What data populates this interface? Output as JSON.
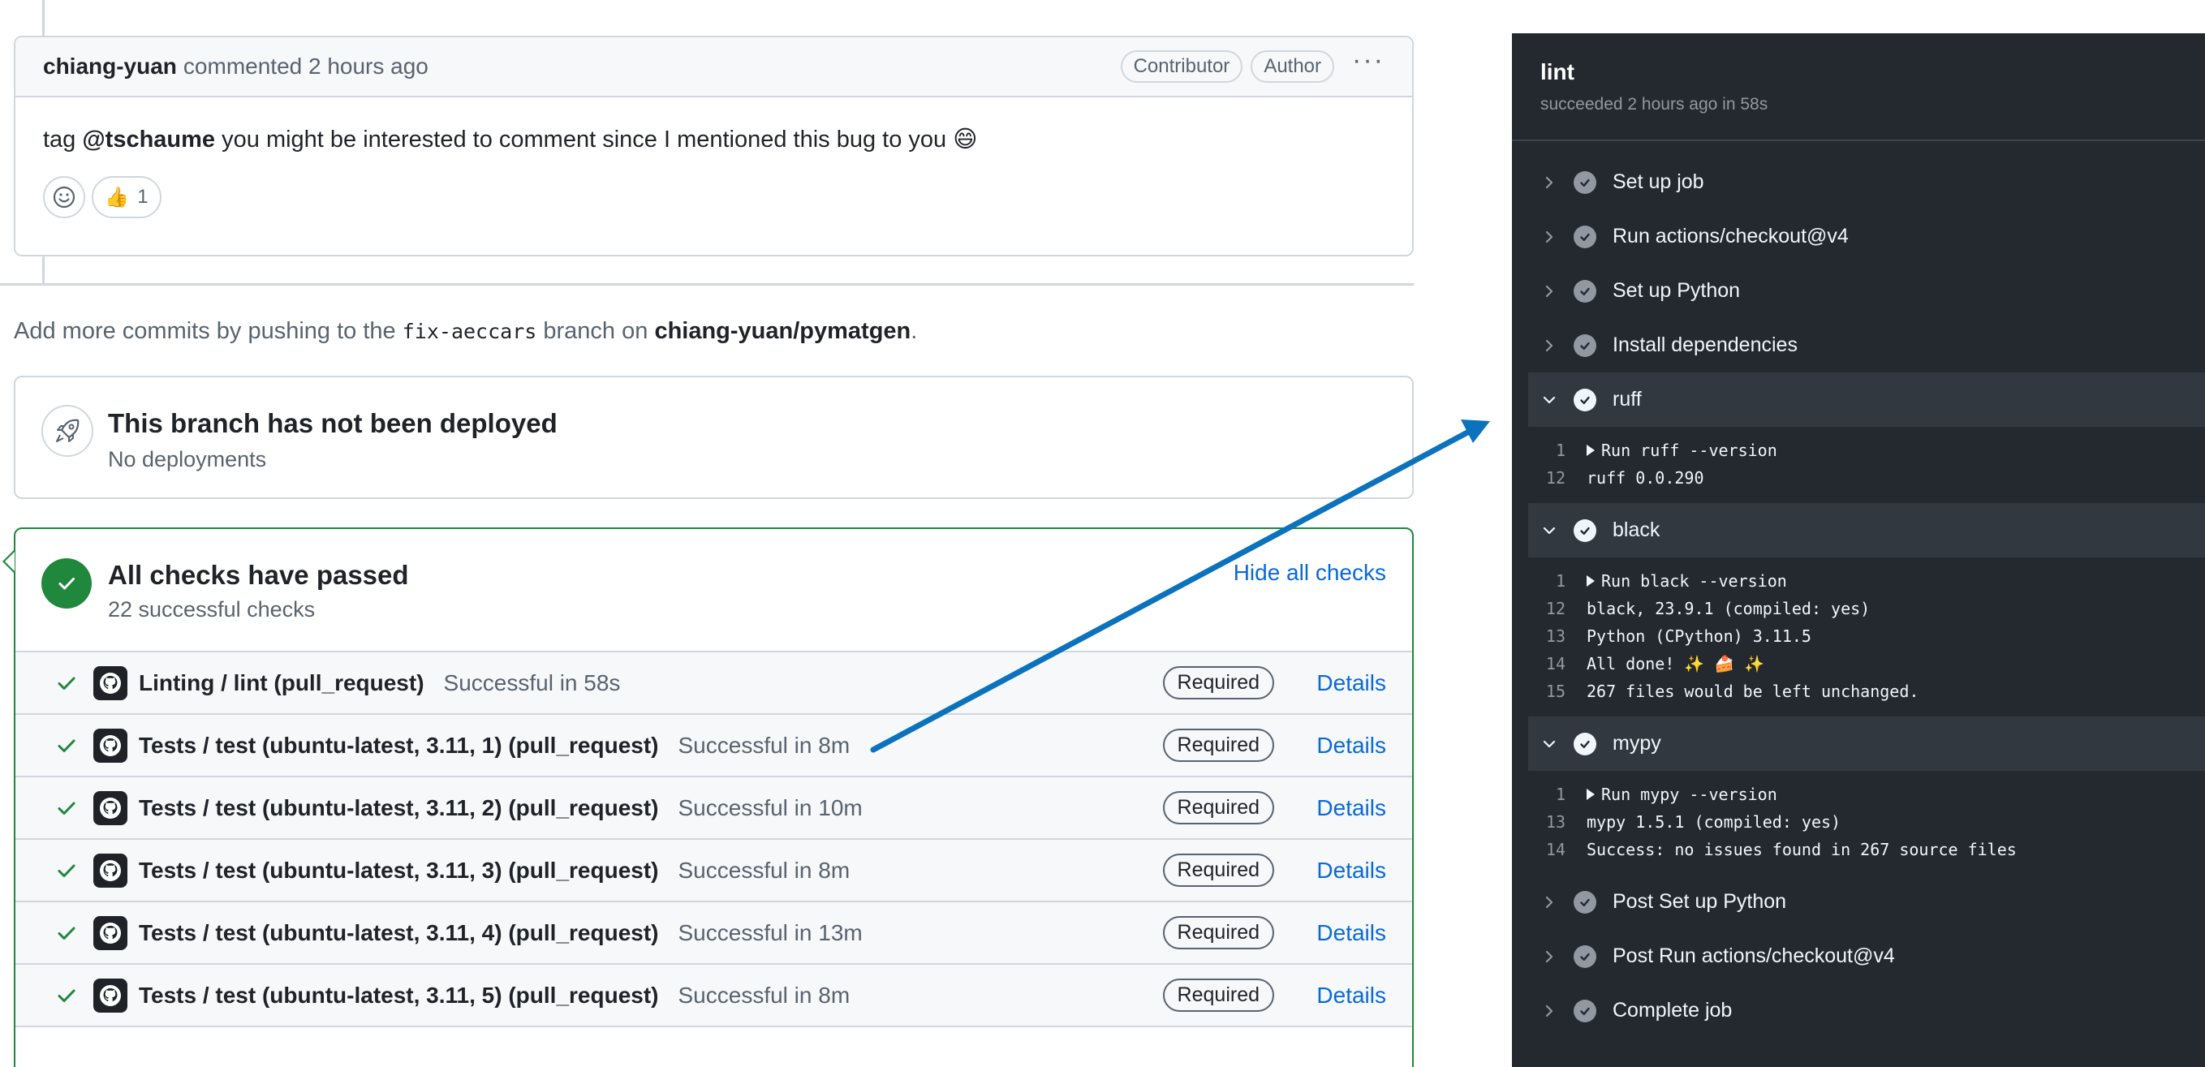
{
  "comment": {
    "author": "chiang-yuan",
    "action": "commented 2 hours ago",
    "badges": [
      "Contributor",
      "Author"
    ],
    "body_prefix": "tag",
    "mention": "@tschaume",
    "body_suffix": "you might be interested to comment since I mentioned this bug to you 😄",
    "reaction_emoji": "👍",
    "reaction_count": "1"
  },
  "branch_note": {
    "prefix": "Add more commits by pushing to the",
    "branch": "fix-aeccars",
    "middle": "branch on",
    "repo": "chiang-yuan/pymatgen",
    "suffix": "."
  },
  "deployment": {
    "title": "This branch has not been deployed",
    "subtitle": "No deployments"
  },
  "checks": {
    "title": "All checks have passed",
    "subtitle": "22 successful checks",
    "toggle_label": "Hide all checks",
    "rows": [
      {
        "name": "Linting / lint (pull_request)",
        "status": "Successful in 58s",
        "required": "Required",
        "details": "Details"
      },
      {
        "name": "Tests / test (ubuntu-latest, 3.11, 1) (pull_request)",
        "status": "Successful in 8m",
        "required": "Required",
        "details": "Details"
      },
      {
        "name": "Tests / test (ubuntu-latest, 3.11, 2) (pull_request)",
        "status": "Successful in 10m",
        "required": "Required",
        "details": "Details"
      },
      {
        "name": "Tests / test (ubuntu-latest, 3.11, 3) (pull_request)",
        "status": "Successful in 8m",
        "required": "Required",
        "details": "Details"
      },
      {
        "name": "Tests / test (ubuntu-latest, 3.11, 4) (pull_request)",
        "status": "Successful in 13m",
        "required": "Required",
        "details": "Details"
      },
      {
        "name": "Tests / test (ubuntu-latest, 3.11, 5) (pull_request)",
        "status": "Successful in 8m",
        "required": "Required",
        "details": "Details"
      }
    ]
  },
  "job_panel": {
    "title": "lint",
    "subtitle": "succeeded 2 hours ago in 58s",
    "steps": {
      "setup_job": "Set up job",
      "checkout": "Run actions/checkout@v4",
      "setup_python": "Set up Python",
      "install_deps": "Install dependencies",
      "ruff": "ruff",
      "black": "black",
      "mypy": "mypy",
      "post_setup_python": "Post Set up Python",
      "post_checkout": "Post Run actions/checkout@v4",
      "complete_job": "Complete job"
    },
    "logs": {
      "ruff": [
        {
          "n": "1",
          "text": "Run ruff --version",
          "collapsible": true
        },
        {
          "n": "12",
          "text": "ruff 0.0.290",
          "collapsible": false
        }
      ],
      "black": [
        {
          "n": "1",
          "text": "Run black --version",
          "collapsible": true
        },
        {
          "n": "12",
          "text": "black, 23.9.1 (compiled: yes)",
          "collapsible": false
        },
        {
          "n": "13",
          "text": "Python (CPython) 3.11.5",
          "collapsible": false
        },
        {
          "n": "14",
          "text": "All done! ✨ 🍰 ✨",
          "collapsible": false
        },
        {
          "n": "15",
          "text": "267 files would be left unchanged.",
          "collapsible": false
        }
      ],
      "mypy": [
        {
          "n": "1",
          "text": "Run mypy --version",
          "collapsible": true
        },
        {
          "n": "13",
          "text": "mypy 1.5.1 (compiled: yes)",
          "collapsible": false
        },
        {
          "n": "14",
          "text": "Success: no issues found in 267 source files",
          "collapsible": false
        }
      ]
    }
  },
  "colors": {
    "success_green": "#1f883d",
    "link_blue": "#0969da",
    "panel_bg": "#24292f",
    "annotation_arrow": "#0b72bd"
  }
}
